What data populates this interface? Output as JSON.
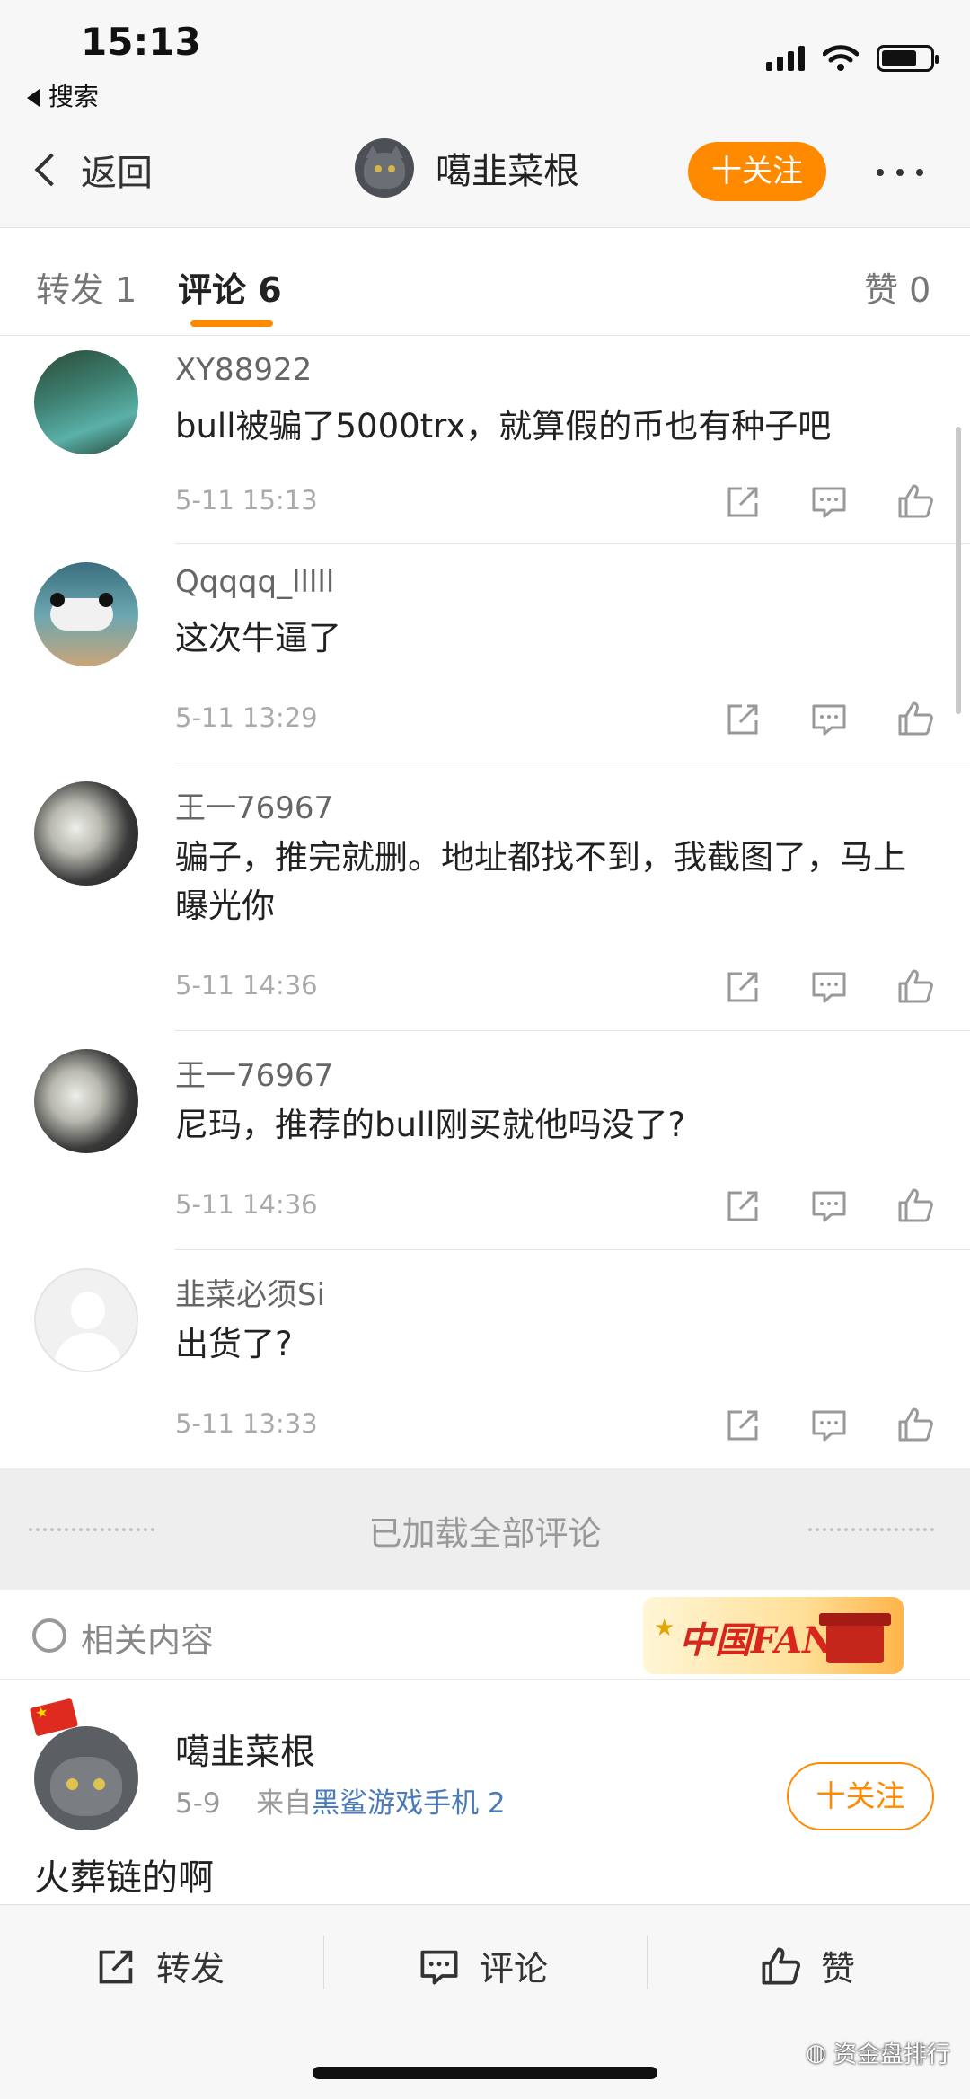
{
  "status_bar": {
    "time": "15:13",
    "back_app": "搜索"
  },
  "nav": {
    "back_label": "返回",
    "username": "噶韭菜根",
    "follow_label": "十关注"
  },
  "tabs": [
    {
      "label": "转发 1"
    },
    {
      "label": "评论 6"
    },
    {
      "label": "赞 0"
    }
  ],
  "comments": [
    {
      "user": "XY88922",
      "text": "bull被骗了5000trx，就算假的币也有种子吧",
      "time": "5-11 15:13"
    },
    {
      "user": "Qqqqq_lllll",
      "text": "这次牛逼了",
      "time": "5-11 13:29"
    },
    {
      "user": "王一76967",
      "text": "骗子，推完就删。地址都找不到，我截图了，马上曝光你",
      "time": "5-11 14:36"
    },
    {
      "user": "王一76967",
      "text": "尼玛，推荐的bull刚买就他吗没了?",
      "time": "5-11 14:36"
    },
    {
      "user": "韭菜必须Si",
      "text": "出货了?",
      "time": "5-11 13:33"
    }
  ],
  "loaded_all": "已加载全部评论",
  "related": {
    "label": "相关内容",
    "badge": "中国FANS"
  },
  "post": {
    "user": "噶韭菜根",
    "date": "5-9",
    "from_prefix": "来自",
    "source": "黑鲨游戏手机 2",
    "follow_label": "十关注",
    "text": "火葬链的啊"
  },
  "toolbar": {
    "repost": "转发",
    "comment": "评论",
    "like": "赞"
  },
  "watermark": "资金盘排行",
  "colors": {
    "accent": "#ff8a00",
    "link": "#4a7bb8"
  }
}
